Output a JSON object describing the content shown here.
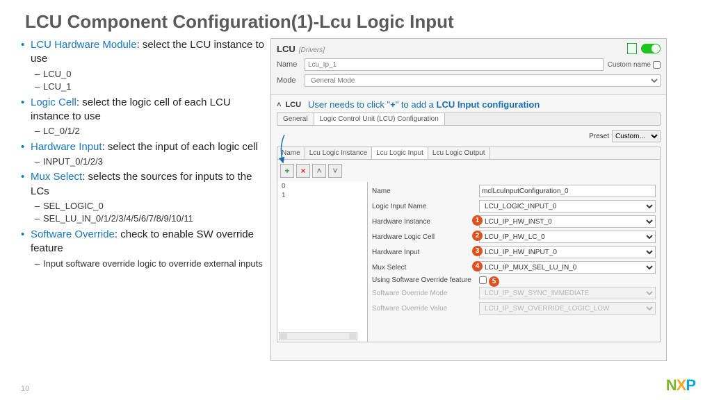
{
  "title": "LCU Component Configuration(1)-Lcu Logic Input",
  "bullets": {
    "hw_module": {
      "term": "LCU Hardware Module",
      "rest": ": select the LCU instance to use",
      "subs": [
        "LCU_0",
        "LCU_1"
      ]
    },
    "logic_cell": {
      "term": "Logic Cell",
      "rest": ": select the logic cell of each LCU instance to use",
      "subs": [
        "LC_0/1/2"
      ]
    },
    "hw_input": {
      "term": "Hardware Input",
      "rest": ": select the input of each logic cell",
      "subs": [
        "INPUT_0/1/2/3"
      ]
    },
    "mux_sel": {
      "term": "Mux Select",
      "rest": ": selects the sources for inputs to the LCs",
      "subs": [
        "SEL_LOGIC_0",
        "SEL_LU_IN_0/1/2/3/4/5/6/7/8/9/10/11"
      ]
    },
    "sw_ovr": {
      "term": "Software Override",
      "rest": ": check to enable SW override feature",
      "subs": [
        "Input software override logic to override external inputs"
      ]
    }
  },
  "panel": {
    "title": "LCU",
    "subtitle": "[Drivers]",
    "name_label": "Name",
    "name_value": "Lcu_Ip_1",
    "custom_label": "Custom name",
    "mode_label": "Mode",
    "mode_value": "General Mode",
    "lcu_label": "LCU",
    "hint_pre": "User needs to click \"",
    "hint_plus": "+",
    "hint_mid": "\" to add a ",
    "hint_bold": "LCU Input configuration",
    "tabs": {
      "general": "General",
      "config": "Logic Control Unit (LCU) Configuration"
    },
    "preset_label": "Preset",
    "preset_value": "Custom...",
    "inner_tabs": {
      "name": "Name",
      "inst": "Lcu Logic Instance",
      "input": "Lcu Logic Input",
      "output": "Lcu Logic Output"
    },
    "list": [
      "0",
      "1"
    ],
    "form": {
      "name": {
        "label": "Name",
        "value": "mclLcuInputConfiguration_0"
      },
      "logic_input": {
        "label": "Logic Input Name",
        "value": "LCU_LOGIC_INPUT_0"
      },
      "hw_inst": {
        "label": "Hardware Instance",
        "value": "LCU_IP_HW_INST_0"
      },
      "hw_lc": {
        "label": "Hardware Logic Cell",
        "value": "LCU_IP_HW_LC_0"
      },
      "hw_in": {
        "label": "Hardware Input",
        "value": "LCU_IP_HW_INPUT_0"
      },
      "mux": {
        "label": "Mux Select",
        "value": "LCU_IP_MUX_SEL_LU_IN_0"
      },
      "sw_feat": {
        "label": "Using Software Override feature"
      },
      "sw_mode": {
        "label": "Software Override Mode",
        "value": "LCU_IP_SW_SYNC_IMMEDIATE"
      },
      "sw_val": {
        "label": "Software Override Value",
        "value": "LCU_IP_SW_OVERRIDE_LOGIC_LOW"
      }
    },
    "markers": {
      "m1": "1",
      "m2": "2",
      "m3": "3",
      "m4": "4",
      "m5": "5"
    }
  },
  "page_number": "10"
}
